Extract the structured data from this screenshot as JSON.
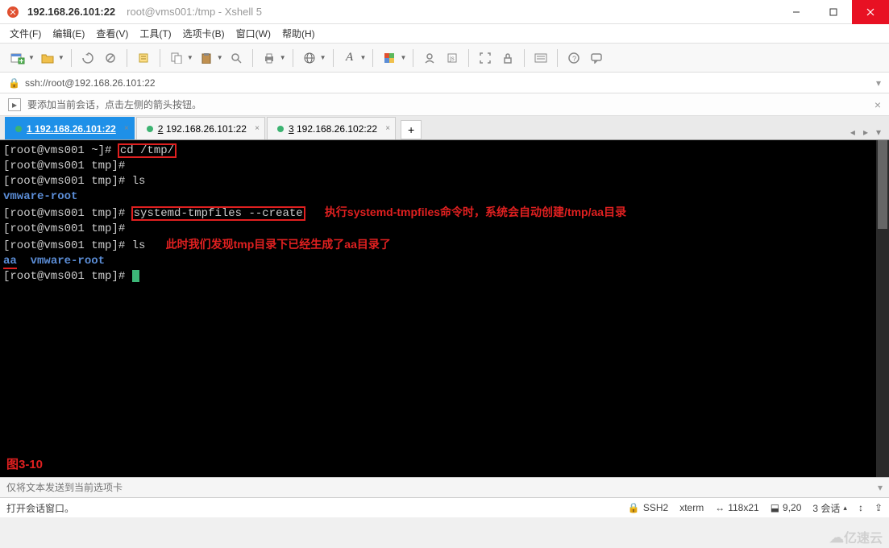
{
  "window": {
    "title_main": "192.168.26.101:22",
    "title_sub": "root@vms001:/tmp - Xshell 5"
  },
  "menu": {
    "items": [
      "文件(F)",
      "编辑(E)",
      "查看(V)",
      "工具(T)",
      "选项卡(B)",
      "窗口(W)",
      "帮助(H)"
    ]
  },
  "address": {
    "url": "ssh://root@192.168.26.101:22"
  },
  "infobar": {
    "text": "要添加当前会话，点击左侧的箭头按钮。"
  },
  "tabs": {
    "items": [
      {
        "num": "1",
        "label": "192.168.26.101:22",
        "active": true
      },
      {
        "num": "2",
        "label": "192.168.26.101:22",
        "active": false
      },
      {
        "num": "3",
        "label": "192.168.26.102:22",
        "active": false
      }
    ],
    "add": "+"
  },
  "terminal": {
    "lines": {
      "l1_prompt": "[root@vms001 ~]# ",
      "l1_cmd": "cd /tmp/",
      "l2": "[root@vms001 tmp]#",
      "l3": "[root@vms001 tmp]# ls",
      "l4": "vmware-root",
      "l5_prompt": "[root@vms001 tmp]# ",
      "l5_cmd": "systemd-tmpfiles --create",
      "l5_anno": "执行systemd-tmpfiles命令时，系统会自动创建/tmp/aa目录",
      "l6": "[root@vms001 tmp]#",
      "l7_prompt": "[root@vms001 tmp]# ls   ",
      "l7_anno": "此时我们发现tmp目录下已经生成了aa目录了",
      "l8_aa": "aa",
      "l8_rest": "  vmware-root",
      "l9": "[root@vms001 tmp]# "
    },
    "figure_label": "图3-10"
  },
  "sendbar": {
    "placeholder": "仅将文本发送到当前选项卡"
  },
  "status": {
    "left": "打开会话窗口。",
    "ssh": "SSH2",
    "term": "xterm",
    "size": "118x21",
    "pos": "9,20",
    "sessions": "3 会话"
  },
  "watermark": "亿速云",
  "icons": {
    "lock": "🔒",
    "size": "↔",
    "pos": "⬓",
    "updown": "↕",
    "caps": "⇪"
  }
}
